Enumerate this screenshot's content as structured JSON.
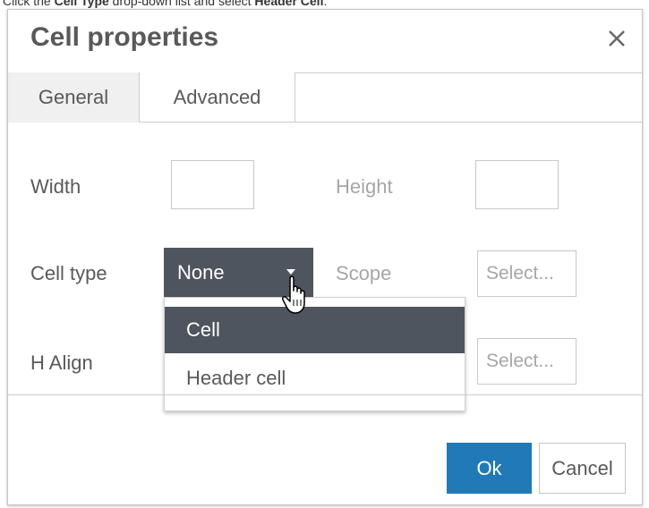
{
  "instruction": {
    "prefix": "Click the ",
    "bold1": "Cell Type",
    "middle": " drop-down list and select ",
    "bold2": "Header Cell",
    "suffix": "."
  },
  "dialog": {
    "title": "Cell properties",
    "close_icon": "close-icon",
    "tabs": [
      {
        "label": "General",
        "active": true
      },
      {
        "label": "Advanced",
        "active": false
      }
    ],
    "fields": {
      "width_label": "Width",
      "width_value": "",
      "height_label": "Height",
      "height_value": "",
      "cell_type_label": "Cell type",
      "cell_type_value": "None",
      "scope_label": "Scope",
      "scope_value": "Select...",
      "h_align_label": "H Align",
      "h_align_value": "Select..."
    },
    "dropdown": {
      "options": [
        "Cell",
        "Header cell"
      ],
      "highlighted": "Cell"
    },
    "footer": {
      "ok_label": "Ok",
      "cancel_label": "Cancel"
    }
  },
  "colors": {
    "primary": "#207ab7",
    "dark_select": "#4f555e",
    "text": "#595959",
    "muted_text": "#a6a6a6",
    "border": "#cccccc"
  }
}
